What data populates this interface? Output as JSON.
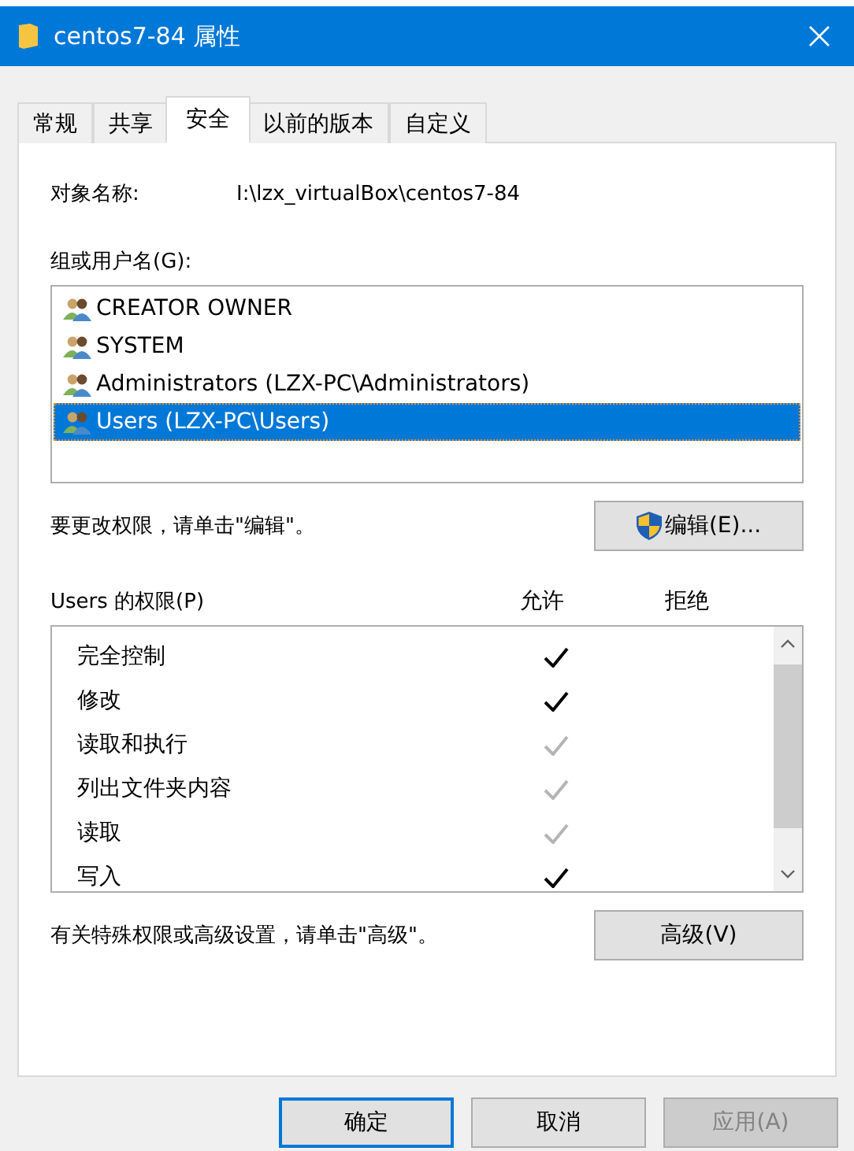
{
  "window": {
    "title": "centos7-84 属性"
  },
  "tabs": [
    {
      "label": "常规",
      "selected": false
    },
    {
      "label": "共享",
      "selected": false
    },
    {
      "label": "安全",
      "selected": true
    },
    {
      "label": "以前的版本",
      "selected": false
    },
    {
      "label": "自定义",
      "selected": false
    }
  ],
  "object_name": {
    "label": "对象名称:",
    "value": "I:\\lzx_virtualBox\\centos7-84"
  },
  "groups": {
    "label": "组或用户名(G):",
    "items": [
      {
        "name": "CREATOR OWNER",
        "selected": false
      },
      {
        "name": "SYSTEM",
        "selected": false
      },
      {
        "name": "Administrators (LZX-PC\\Administrators)",
        "selected": false
      },
      {
        "name": "Users (LZX-PC\\Users)",
        "selected": true
      }
    ]
  },
  "edit_hint": "要更改权限，请单击\"编辑\"。",
  "edit_button": "编辑(E)...",
  "permissions": {
    "label": "Users 的权限(P)",
    "allow_header": "允许",
    "deny_header": "拒绝",
    "items": [
      {
        "name": "完全控制",
        "allow": true,
        "inherited": false,
        "deny": false
      },
      {
        "name": "修改",
        "allow": true,
        "inherited": false,
        "deny": false
      },
      {
        "name": "读取和执行",
        "allow": true,
        "inherited": true,
        "deny": false
      },
      {
        "name": "列出文件夹内容",
        "allow": true,
        "inherited": true,
        "deny": false
      },
      {
        "name": "读取",
        "allow": true,
        "inherited": true,
        "deny": false
      },
      {
        "name": "写入",
        "allow": true,
        "inherited": false,
        "deny": false
      }
    ]
  },
  "advanced_hint": "有关特殊权限或高级设置，请单击\"高级\"。",
  "advanced_button": "高级(V)",
  "buttons": [
    {
      "label": "确定",
      "default": true,
      "disabled": false
    },
    {
      "label": "取消",
      "default": false,
      "disabled": false
    },
    {
      "label": "应用(A)",
      "default": false,
      "disabled": true
    }
  ]
}
